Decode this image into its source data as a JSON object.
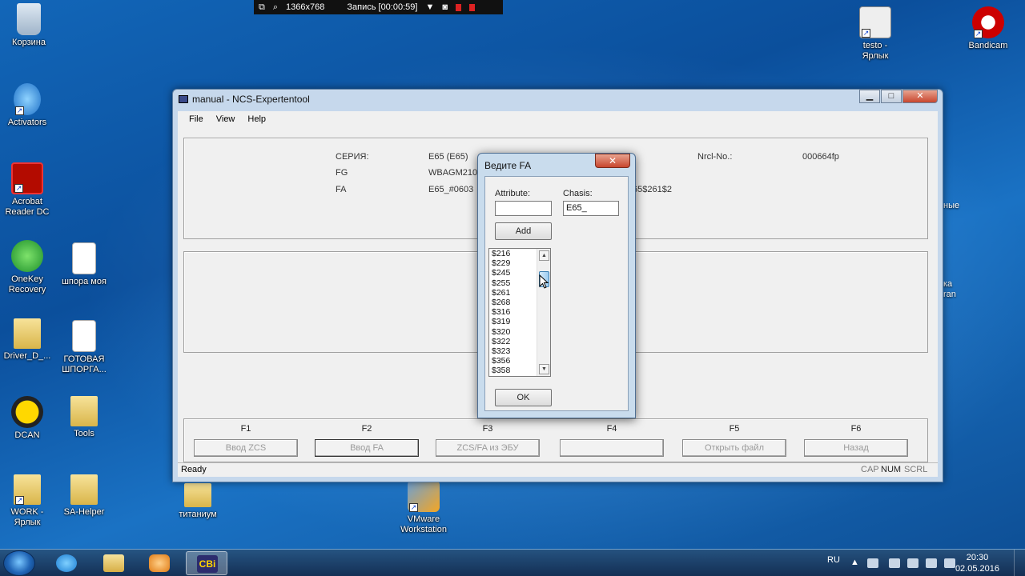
{
  "recorder": {
    "resolution": "1366x768",
    "recording": "Запись [00:00:59]"
  },
  "desktop_icons": {
    "recycle": "Корзина",
    "activators": "Activators",
    "acrobat": "Acrobat Reader DC",
    "onekey": "OneKey Recovery",
    "shpora": "шпора моя",
    "driver": "Driver_D_...",
    "gotovaya": "ГОТОВАЯ ШПОРГА...",
    "dcan": "DCAN",
    "tools": "Tools",
    "work": "WORK - Ярлык",
    "sahelper": "SA-Helper",
    "titanium": "титаниум",
    "vmware": "VMware Workstation",
    "testo": "testo - Ярлык",
    "bandicam": "Bandicam",
    "partial_1": "ные",
    "partial_2": "ка\nran"
  },
  "window": {
    "title": "manual - NCS-Expertentool",
    "menu": [
      "File",
      "View",
      "Help"
    ],
    "info": {
      "series_label": "СЕРИЯ:",
      "series_value": "E65 (E65)",
      "fg_label": "FG",
      "fg_value": "WBAGM210",
      "fa_label": "FA",
      "fa_value": "E65_#0603",
      "fa_tail": "65$261$2",
      "ncl_label": "Nrcl-No.:",
      "ncl_value": "000664fp"
    },
    "fkeys": [
      "F1",
      "F2",
      "F3",
      "F4",
      "F5",
      "F6"
    ],
    "fbuttons": [
      "Ввод ZCS",
      "Ввод FA",
      "ZCS/FA из ЭБУ",
      "",
      "Открыть файл",
      "Назад"
    ],
    "status": {
      "ready": "Ready",
      "cap": "CAP",
      "num": "NUM",
      "scrl": "SCRL"
    }
  },
  "dialog": {
    "title": "Ведите FA",
    "attribute_label": "Attribute:",
    "attribute_value": "",
    "chasis_label": "Chasis:",
    "chasis_value": "E65_",
    "add_label": "Add",
    "list_items": [
      "$216",
      "$229",
      "$245",
      "$255",
      "$261",
      "$268",
      "$316",
      "$319",
      "$320",
      "$322",
      "$323",
      "$356",
      "$358"
    ],
    "ok_label": "OK"
  },
  "taskbar": {
    "lang": "RU",
    "time": "20:30",
    "date": "02.05.2016",
    "app_label": "СВі"
  }
}
